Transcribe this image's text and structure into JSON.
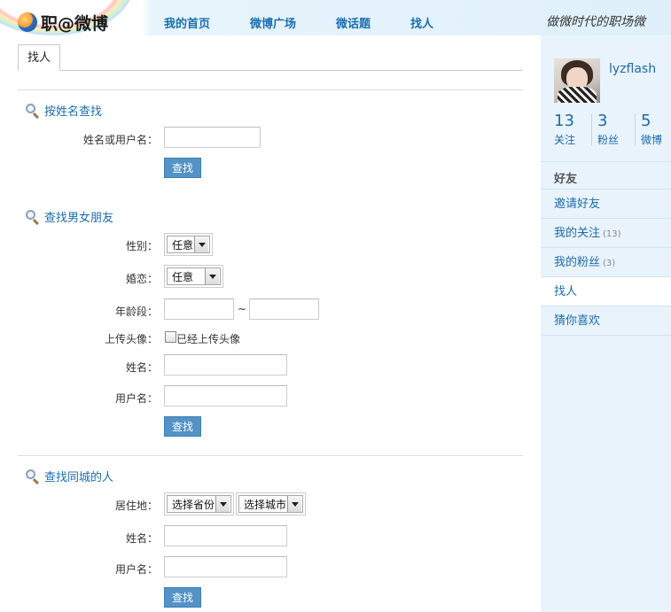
{
  "header": {
    "logo_text": "职@微博",
    "nav": [
      "我的首页",
      "微博广场",
      "微话题",
      "找人"
    ],
    "slogan": "做微时代的职场微"
  },
  "tab": {
    "label": "找人"
  },
  "section_name": {
    "title": "按姓名查找",
    "field_label": "姓名或用户名：",
    "button": "查找"
  },
  "section_friend": {
    "title": "查找男女朋友",
    "gender_label": "性别：",
    "gender_value": "任意",
    "marriage_label": "婚恋：",
    "marriage_value": "任意",
    "age_label": "年龄段：",
    "age_sep": "~",
    "avatar_label": "上传头像：",
    "avatar_check": "已经上传头像",
    "name_label": "姓名：",
    "username_label": "用户名：",
    "button": "查找"
  },
  "section_city": {
    "title": "查找同城的人",
    "location_label": "居住地：",
    "province_value": "选择省份",
    "city_value": "选择城市",
    "name_label": "姓名：",
    "username_label": "用户名：",
    "button": "查找"
  },
  "sidebar": {
    "username": "lyzflash",
    "stats": [
      {
        "num": "13",
        "label": "关注"
      },
      {
        "num": "3",
        "label": "粉丝"
      },
      {
        "num": "5",
        "label": "微博"
      }
    ],
    "heading": "好友",
    "items": [
      {
        "label": "邀请好友",
        "count": ""
      },
      {
        "label": "我的关注",
        "count": "(13)"
      },
      {
        "label": "我的粉丝",
        "count": "(3)"
      },
      {
        "label": "找人",
        "count": ""
      },
      {
        "label": "猜你喜欢",
        "count": ""
      }
    ]
  },
  "colors": {
    "accent": "#1b6cb0",
    "button": "#5393c5",
    "sidebar_bg": "#e9f3fb"
  }
}
